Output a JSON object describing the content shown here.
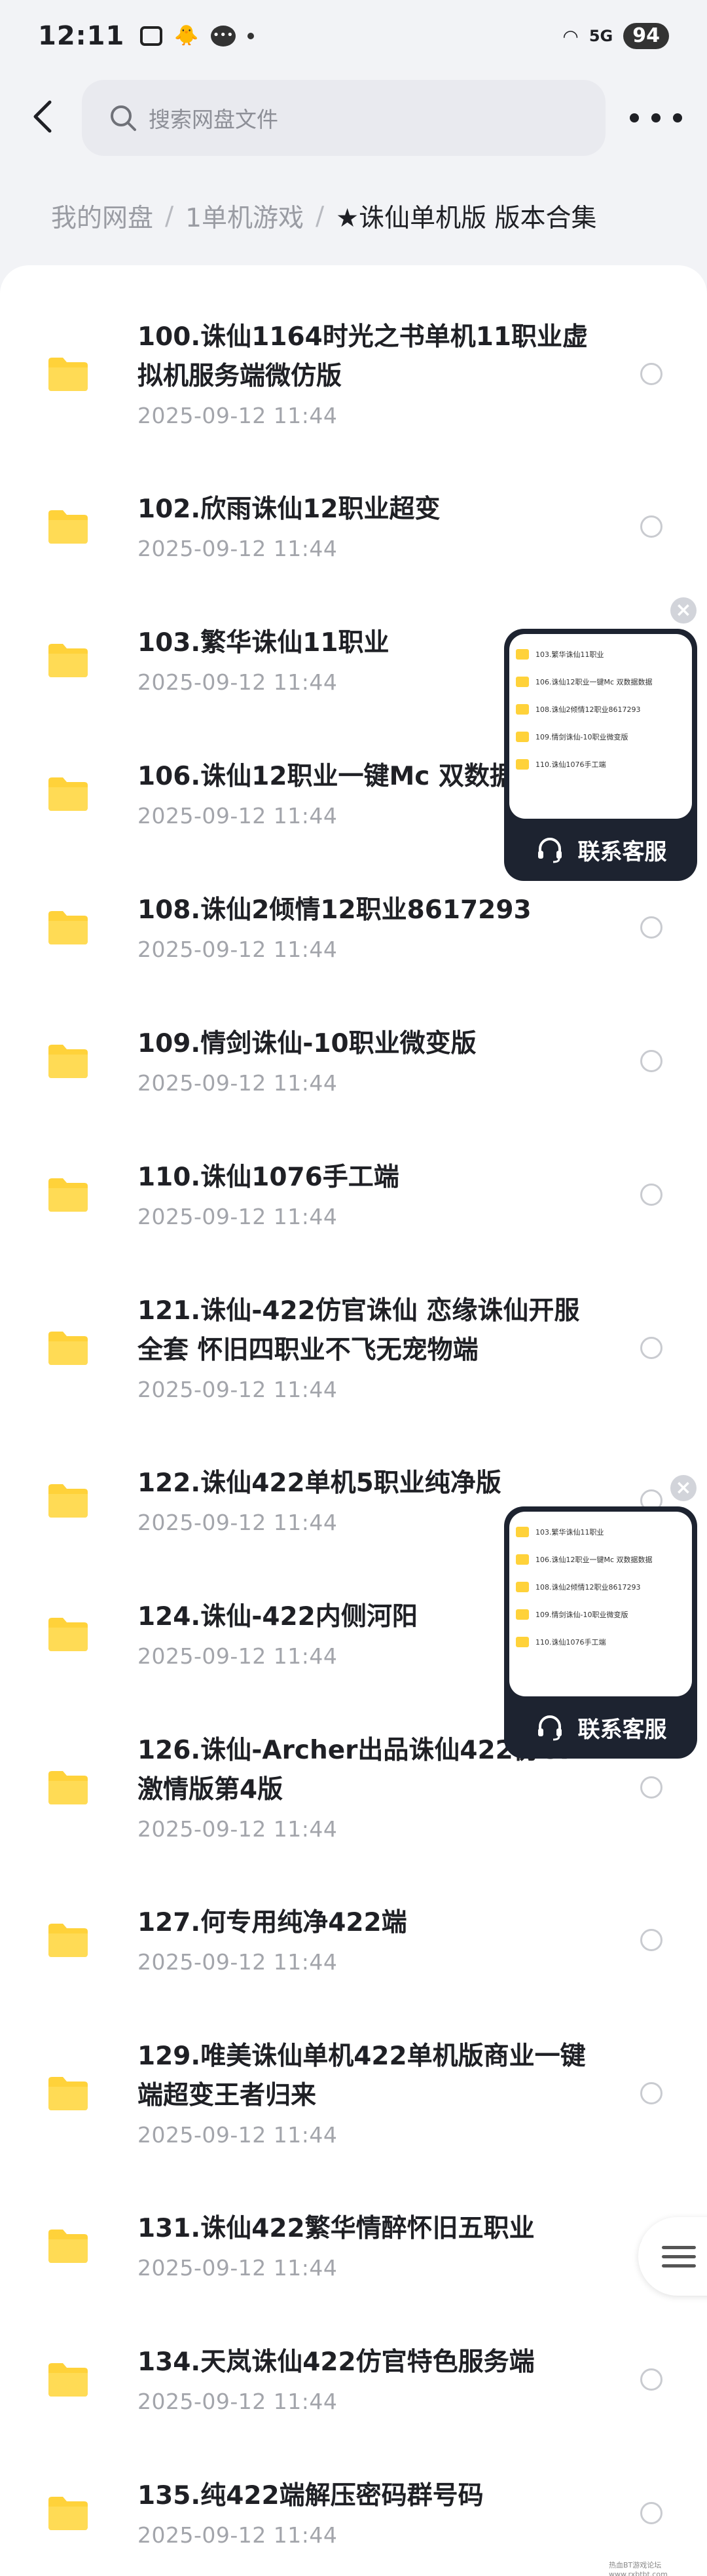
{
  "status_bar": {
    "time": "12:11",
    "network": "5G",
    "battery": "94"
  },
  "header": {
    "search_placeholder": "搜索网盘文件"
  },
  "breadcrumb": {
    "items": [
      "我的网盘",
      "1单机游戏"
    ],
    "separator": "/",
    "current": "★诛仙单机版 版本合集"
  },
  "files": [
    {
      "name": "100.诛仙1164时光之书单机11职业虚拟机服务端微仿版",
      "date": "2025-09-12  11:44"
    },
    {
      "name": "102.欣雨诛仙12职业超变",
      "date": "2025-09-12  11:44"
    },
    {
      "name": "103.繁华诛仙11职业",
      "date": "2025-09-12  11:44"
    },
    {
      "name": "106.诛仙12职业一键Mc 双数据",
      "date": "2025-09-12  11:44"
    },
    {
      "name": "108.诛仙2倾情12职业8617293",
      "date": "2025-09-12  11:44"
    },
    {
      "name": "109.情剑诛仙-10职业微变版",
      "date": "2025-09-12  11:44"
    },
    {
      "name": "110.诛仙1076手工端",
      "date": "2025-09-12  11:44"
    },
    {
      "name": "121.诛仙-422仿官诛仙 恋缘诛仙开服全套 怀旧四职业不飞无宠物端",
      "date": "2025-09-12  11:44"
    },
    {
      "name": "122.诛仙422单机5职业纯净版",
      "date": "2025-09-12  11:44"
    },
    {
      "name": "124.诛仙-422内侧河阳",
      "date": "2025-09-12  11:44"
    },
    {
      "name": "126.诛仙-Archer出品诛仙422仿GF激情版第4版",
      "date": "2025-09-12  11:44"
    },
    {
      "name": "127.何专用纯净422端",
      "date": "2025-09-12  11:44"
    },
    {
      "name": "129.唯美诛仙单机422单机版商业一键端超变王者归来",
      "date": "2025-09-12  11:44"
    },
    {
      "name": "131.诛仙422繁华情醉怀旧五职业",
      "date": "2025-09-12  11:44"
    },
    {
      "name": "134.天岚诛仙422仿官特色服务端",
      "date": "2025-09-12  11:44"
    },
    {
      "name": "135.纯422端解压密码群号码",
      "date": "2025-09-12  11:44"
    }
  ],
  "cs_widget": {
    "label": "联系客服",
    "close": "×",
    "preview_items": [
      "103.繁华诛仙11职业",
      "106.诛仙12职业一键Mc 双数据数据",
      "108.诛仙2倾情12职业8617293",
      "109.情剑诛仙-10职业微变版",
      "110.诛仙1076手工端"
    ]
  },
  "watermark": "热血BT游戏论坛 www.rxbtbt.com",
  "colors": {
    "folder": "#ffd23a",
    "background": "#f2f3f6",
    "widget": "#1d2330"
  }
}
